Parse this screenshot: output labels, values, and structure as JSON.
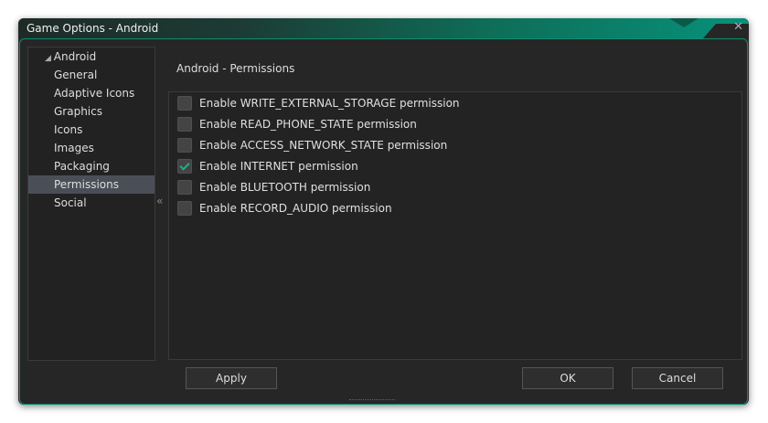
{
  "window": {
    "title": "Game Options - Android",
    "close": "✕"
  },
  "tree": {
    "root": "Android",
    "items": [
      "General",
      "Adaptive Icons",
      "Graphics",
      "Icons",
      "Images",
      "Packaging",
      "Permissions",
      "Social"
    ],
    "selected": "Permissions"
  },
  "collapse": "«",
  "heading": "Android - Permissions",
  "permissions": [
    {
      "label": "Enable WRITE_EXTERNAL_STORAGE permission",
      "checked": false
    },
    {
      "label": "Enable READ_PHONE_STATE permission",
      "checked": false
    },
    {
      "label": "Enable ACCESS_NETWORK_STATE permission",
      "checked": false
    },
    {
      "label": "Enable INTERNET permission",
      "checked": true
    },
    {
      "label": "Enable BLUETOOTH permission",
      "checked": false
    },
    {
      "label": "Enable RECORD_AUDIO permission",
      "checked": false
    }
  ],
  "buttons": {
    "apply": "Apply",
    "ok": "OK",
    "cancel": "Cancel"
  }
}
